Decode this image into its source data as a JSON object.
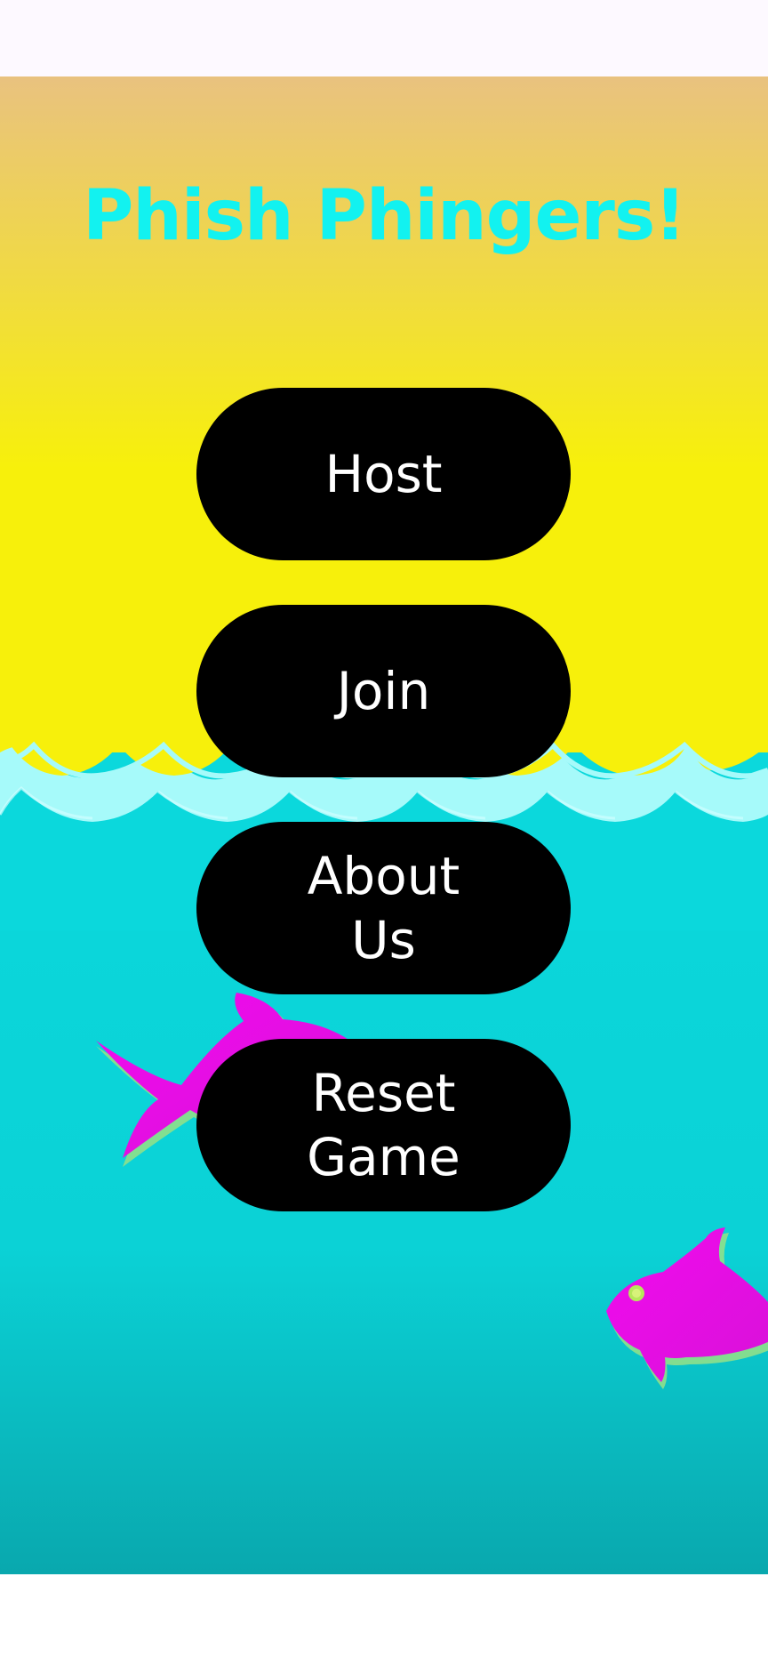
{
  "app": {
    "title": "Phish Phingers!"
  },
  "colors": {
    "title": "#12f2f0",
    "sky_top": "#e9c27f",
    "sky_bottom": "#f7f00b",
    "wave_light": "#a6fafa",
    "water_top": "#0bd8dc",
    "water_bottom": "#09a8ae",
    "fish": "#ee08ec",
    "button_bg": "#000000",
    "button_text": "#ffffff"
  },
  "menu": {
    "host_label": "Host",
    "join_label": "Join",
    "about_label": "About Us",
    "reset_label": "Reset Game"
  },
  "icons": {
    "fish_left": "fish-icon",
    "fish_right": "fish-icon"
  }
}
